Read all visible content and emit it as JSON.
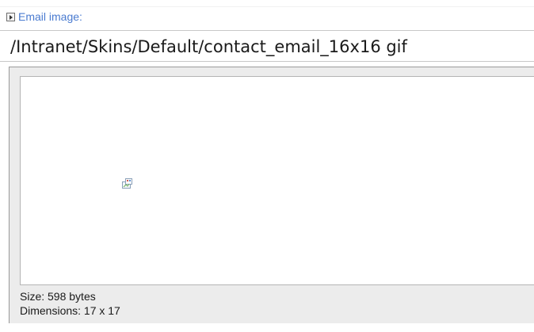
{
  "field": {
    "label": "Email image:",
    "value": "/Intranet/Skins/Default/contact_email_16x16 gif",
    "expanded": false,
    "toggle_icon": "expand-arrow-icon"
  },
  "preview": {
    "image_icon": "broken-image-icon",
    "size_text": "Size: 598 bytes",
    "dimensions_text": "Dimensions: 17 x 17"
  }
}
